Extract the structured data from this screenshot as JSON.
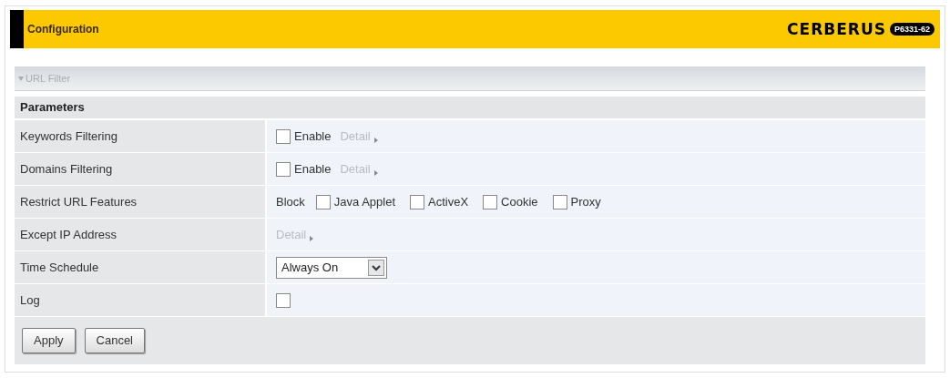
{
  "header": {
    "title": "Configuration",
    "logo": "CERBERUS",
    "model": "P6331-62"
  },
  "section": {
    "title": "URL Filter",
    "expanded": true
  },
  "parameters": {
    "title": "Parameters",
    "rows": [
      {
        "kind": "enable",
        "label": "Keywords Filtering",
        "checked": false,
        "option": "Enable",
        "link": "Detail"
      },
      {
        "kind": "enable",
        "label": "Domains Filtering",
        "checked": false,
        "option": "Enable",
        "link": "Detail"
      },
      {
        "kind": "block",
        "label": "Restrict URL Features",
        "prefix": "Block",
        "options": [
          {
            "label": "Java Applet",
            "checked": false
          },
          {
            "label": "ActiveX",
            "checked": false
          },
          {
            "label": "Cookie",
            "checked": false
          },
          {
            "label": "Proxy",
            "checked": false
          }
        ]
      },
      {
        "kind": "detail",
        "label": "Except IP Address",
        "link": "Detail"
      },
      {
        "kind": "select",
        "label": "Time Schedule",
        "value": "Always On"
      },
      {
        "kind": "checkbox",
        "label": "Log",
        "checked": false
      }
    ]
  },
  "buttons": [
    "Apply",
    "Cancel"
  ]
}
